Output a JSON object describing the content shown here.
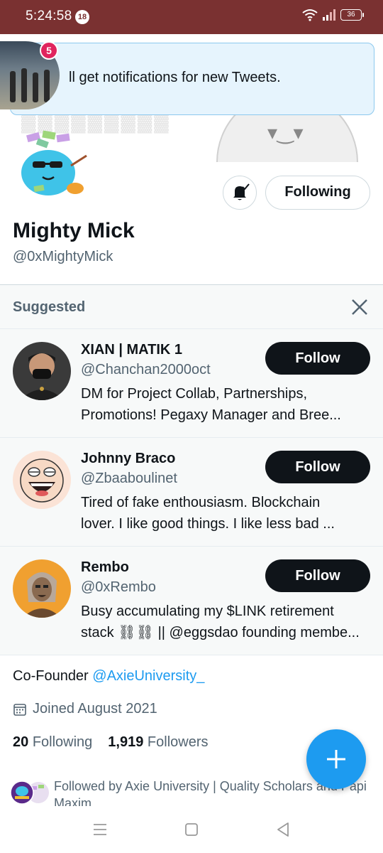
{
  "status_bar": {
    "time": "5:24:58",
    "notification_count": "18",
    "battery": "36"
  },
  "tooltip": {
    "message": "ll get notifications for new Tweets.",
    "badge_count": "5"
  },
  "profile": {
    "name": "Mighty Mick",
    "handle": "@0xMightyMick",
    "following_button": "Following",
    "bio_prefix": "Co-Founder ",
    "bio_link": "@AxieUniversity_",
    "joined": "Joined August 2021",
    "following_count": "20",
    "following_label": "Following",
    "followers_count": "1,919",
    "followers_label": "Followers",
    "followed_by": "Followed by Axie University | Quality Scholars and Papi Maxim"
  },
  "suggested": {
    "title": "Suggested",
    "users": [
      {
        "name": "XIAN | MATIK 1",
        "handle": "@Chanchan2000oct",
        "bio_line1": "DM for Project Collab, Partnerships,",
        "bio_line2": "Promotions! Pegaxy Manager and Bree...",
        "button": "Follow"
      },
      {
        "name": "Johnny Braco",
        "handle": "@Zbaaboulinet",
        "bio_line1": "Tired of fake enthousiasm. Blockchain",
        "bio_line2": "lover. I like good things. I like less bad ...",
        "button": "Follow"
      },
      {
        "name": "Rembo",
        "handle": "@0xRembo",
        "bio_line1": "Busy accumulating my $LINK retirement",
        "bio_line2": "stack ⛓⛓ || @eggsdao founding membe...",
        "button": "Follow"
      }
    ]
  },
  "colors": {
    "status_bar": "#7a3131",
    "accent": "#1d9bf0",
    "follow_button": "#0f1419",
    "tooltip_bg": "#e6f4fd"
  }
}
